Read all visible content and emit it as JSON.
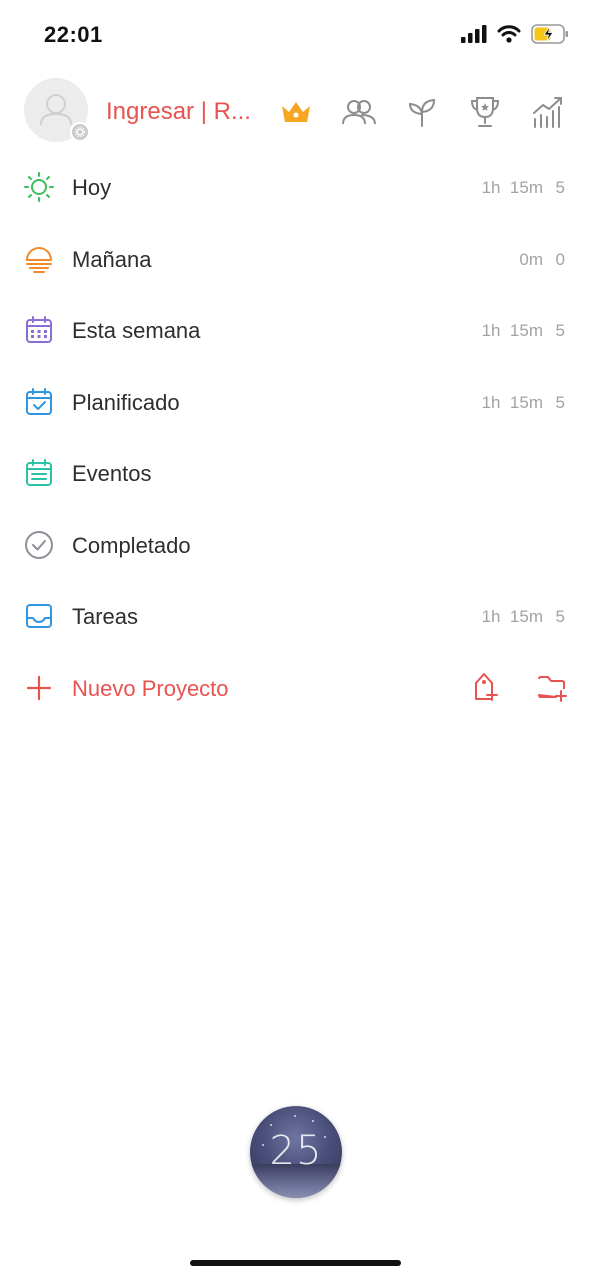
{
  "status_bar": {
    "time": "22:01",
    "icons": [
      "signal-icon",
      "wifi-icon",
      "battery-charging-icon"
    ]
  },
  "header": {
    "login_text": "Ingresar | R...",
    "icons": [
      "crown-icon",
      "people-icon",
      "sprout-icon",
      "trophy-icon",
      "stats-icon"
    ]
  },
  "menu": {
    "items": [
      {
        "label": "Hoy",
        "time": "1h  15m",
        "count": "5",
        "icon": "sun-icon",
        "color": "#3cbf5a"
      },
      {
        "label": "Mañana",
        "time": "0m",
        "count": "0",
        "icon": "sunset-icon",
        "color": "#f08a2c"
      },
      {
        "label": "Esta semana",
        "time": "1h  15m",
        "count": "5",
        "icon": "calendar-week-icon",
        "color": "#8a6ed6"
      },
      {
        "label": "Planificado",
        "time": "1h  15m",
        "count": "5",
        "icon": "calendar-check-icon",
        "color": "#2f96e0"
      },
      {
        "label": "Eventos",
        "time": "",
        "count": "",
        "icon": "calendar-events-icon",
        "color": "#2cc3a4"
      },
      {
        "label": "Completado",
        "time": "",
        "count": "",
        "icon": "check-circle-icon",
        "color": "#8a8f99"
      },
      {
        "label": "Tareas",
        "time": "1h  15m",
        "count": "5",
        "icon": "inbox-icon",
        "color": "#2f96e0"
      }
    ],
    "new_project": {
      "label": "Nuevo Proyecto",
      "icons": [
        "add-tag-icon",
        "add-folder-icon"
      ],
      "color": "#e8524f"
    }
  },
  "timer": {
    "value": "25"
  },
  "colors": {
    "accent": "#e8524f",
    "crown": "#f5a623",
    "muted": "#a3a3a3"
  }
}
